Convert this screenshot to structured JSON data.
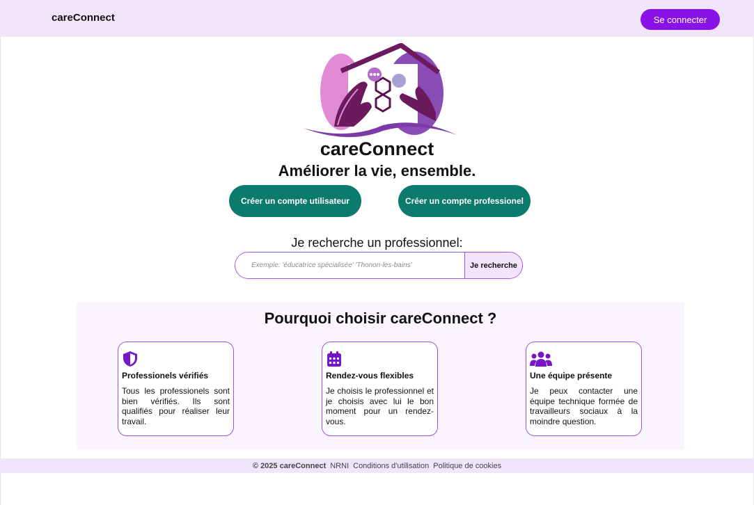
{
  "header": {
    "brand": "careConnect",
    "login_label": "Se connecter"
  },
  "hero": {
    "logo_icon": "care-house-hands-logo",
    "title": "careConnect",
    "tagline": "Améliorer la vie, ensemble.",
    "cta_user_label": "Créer un compte utilisateur",
    "cta_pro_label": "Créer un compte professionel"
  },
  "search": {
    "label": "Je recherche un professionnel:",
    "placeholder": "Exemple: 'éducatrice spécialisée' 'Thonon-les-bains'",
    "button_label": "Je recherche"
  },
  "why": {
    "title_prefix": "Pourquoi choisir",
    "title_brand": "careConnect",
    "title_suffix": " ?",
    "cards": [
      {
        "icon": "shield-icon",
        "title": "Professionels vérifiés",
        "text": "Tous les professionels sont bien vérifiés. Ils sont qualifiés pour réaliser leur travail."
      },
      {
        "icon": "calendar-icon",
        "title": "Rendez-vous flexibles",
        "text": "Je choisis le professionnel et je choisis avec lui le bon moment pour un rendez-vous."
      },
      {
        "icon": "team-icon",
        "title": "Une équipe présente",
        "text": "Je peux contacter une équipe technique formée de travailleurs sociaux à la moindre question."
      }
    ]
  },
  "footer": {
    "copyright": "© 2025 careConnect",
    "links": [
      "NRNI",
      "Conditions d'utilisation",
      "Politique de cookies"
    ]
  },
  "colors": {
    "accent": "#8a12e6",
    "cta": "#0c7a6d",
    "header_bg": "#f0e5fb",
    "section_bg": "#f9f4fd"
  }
}
